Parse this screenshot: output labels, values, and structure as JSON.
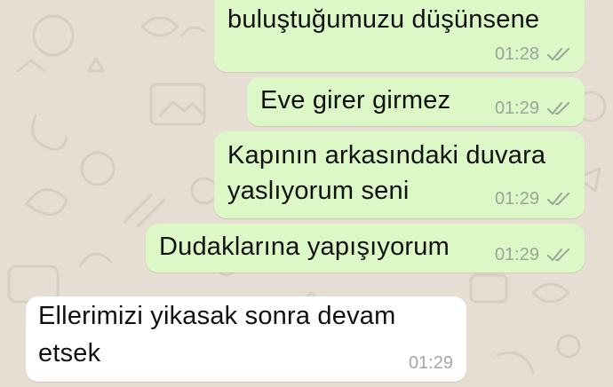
{
  "chat": {
    "messages": [
      {
        "direction": "outgoing",
        "text_lines": [
          "buluştuğumuzu düşünsene"
        ],
        "time": "01:28",
        "status_icon": "double-check-icon"
      },
      {
        "direction": "outgoing",
        "text_lines": [
          "Eve girer girmez"
        ],
        "time": "01:29",
        "status_icon": "double-check-icon"
      },
      {
        "direction": "outgoing",
        "text_lines": [
          "Kapının arkasındaki duvara",
          "yaslıyorum seni"
        ],
        "time": "01:29",
        "status_icon": "double-check-icon"
      },
      {
        "direction": "outgoing",
        "text_lines": [
          "Dudaklarına yapışıyorum"
        ],
        "time": "01:29",
        "status_icon": "double-check-icon"
      },
      {
        "direction": "incoming",
        "text_lines": [
          "Ellerimizi yikasak sonra devam",
          "etsek"
        ],
        "time": "01:29"
      }
    ]
  },
  "colors": {
    "wallpaper": "#e6ded3",
    "outgoing_bubble": "#dcf8c6",
    "incoming_bubble": "#ffffff",
    "timestamp": "#9aa59a",
    "ticks": "#9aa59a"
  }
}
